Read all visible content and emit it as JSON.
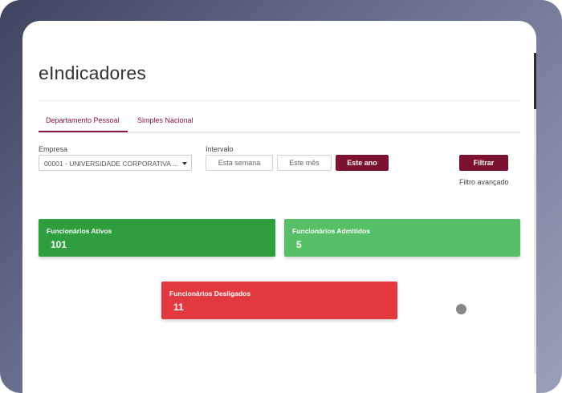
{
  "app": {
    "title": "eIndicadores"
  },
  "tabs": [
    {
      "label": "Departamento Pessoal",
      "active": true
    },
    {
      "label": "Simples Nacional",
      "active": false
    }
  ],
  "filters": {
    "empresa_label": "Empresa",
    "empresa_value": "00001 - UNIVERSIDADE CORPORATIVA ...",
    "intervalo_label": "Intervalo",
    "intervalo_options": [
      "Esta semana",
      "Este mês",
      "Este ano"
    ],
    "intervalo_selected": "Este ano",
    "filtrar_label": "Filtrar",
    "advanced_label": "Filtro avançado"
  },
  "cards": [
    {
      "title": "Funcionários Ativos",
      "value": "101",
      "color": "#2e9e3e"
    },
    {
      "title": "Funcionários Admitidos",
      "value": "5",
      "color": "#57bf68"
    },
    {
      "title": "Funcionários Desligados",
      "value": "11",
      "color": "#e2393f"
    }
  ],
  "colors": {
    "accent": "#7c1230",
    "frame": "#555b78"
  }
}
